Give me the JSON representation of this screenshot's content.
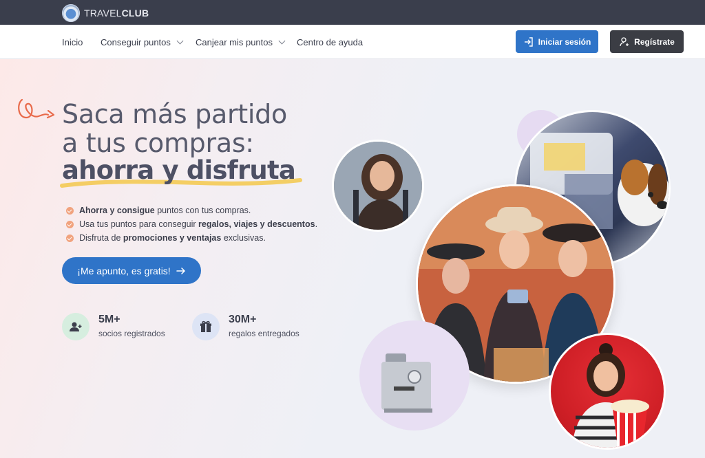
{
  "brand": {
    "name_light": "TRAVEL",
    "name_bold": "CLUB"
  },
  "nav": {
    "items": [
      {
        "label": "Inicio"
      },
      {
        "label": "Conseguir puntos"
      },
      {
        "label": "Canjear mis puntos"
      },
      {
        "label": "Centro de ayuda"
      }
    ],
    "login_label": "Iniciar sesión",
    "register_label": "Regístrate"
  },
  "hero": {
    "line1": "Saca más partido",
    "line2": "a tus compras:",
    "line3": "ahorra y disfruta",
    "benefits": [
      {
        "pre": "",
        "bold1": "Ahorra y consigue",
        "mid": " puntos con tus compras.",
        "bold2": "",
        "post": ""
      },
      {
        "pre": "Usa tus puntos para conseguir ",
        "bold1": "regalos, viajes y descuentos",
        "mid": ".",
        "bold2": "",
        "post": ""
      },
      {
        "pre": "Disfruta de ",
        "bold1": "promociones y ventajas",
        "mid": " exclusivas.",
        "bold2": "",
        "post": ""
      }
    ],
    "cta_label": "¡Me apunto, es gratis!",
    "stats": [
      {
        "number": "5M+",
        "label": "socios registrados"
      },
      {
        "number": "30M+",
        "label": "regalos entregados"
      }
    ]
  },
  "colors": {
    "accent": "#2f74c8",
    "dark_button": "#3b3d44",
    "brand_bar": "#3a3e4c",
    "highlight": "#f3c84b",
    "bullet": "#f1a37e"
  }
}
